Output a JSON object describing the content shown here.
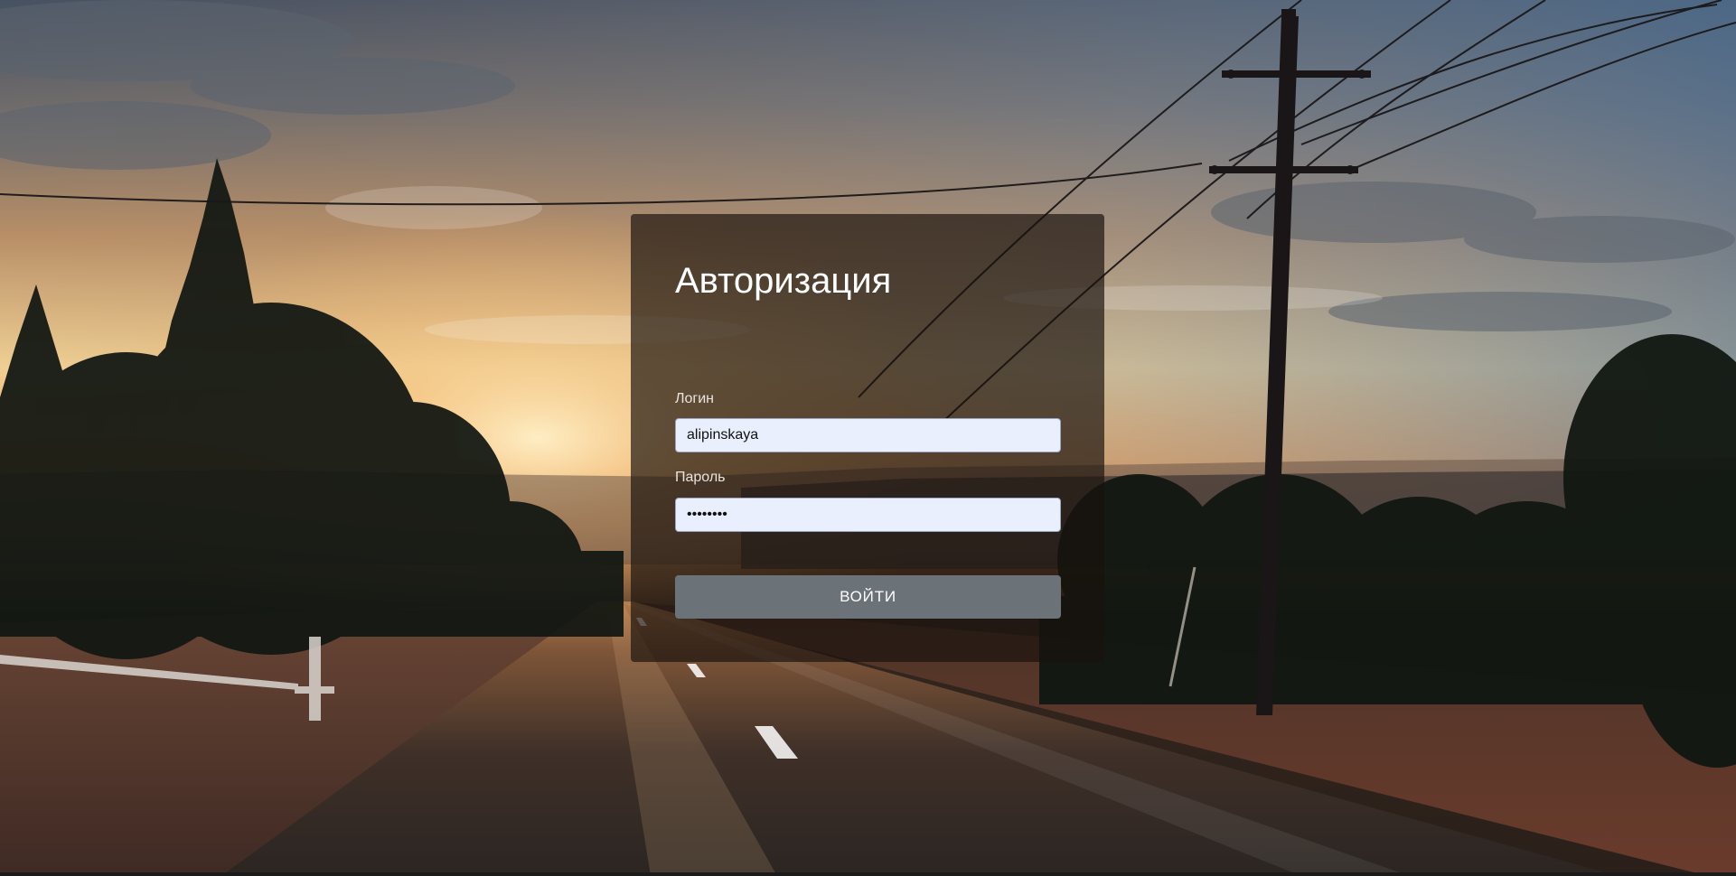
{
  "login_form": {
    "title": "Авторизация",
    "login_label": "Логин",
    "login_value": "alipinskaya",
    "password_label": "Пароль",
    "password_value": "••••••••",
    "submit_label": "ВОЙТИ"
  }
}
